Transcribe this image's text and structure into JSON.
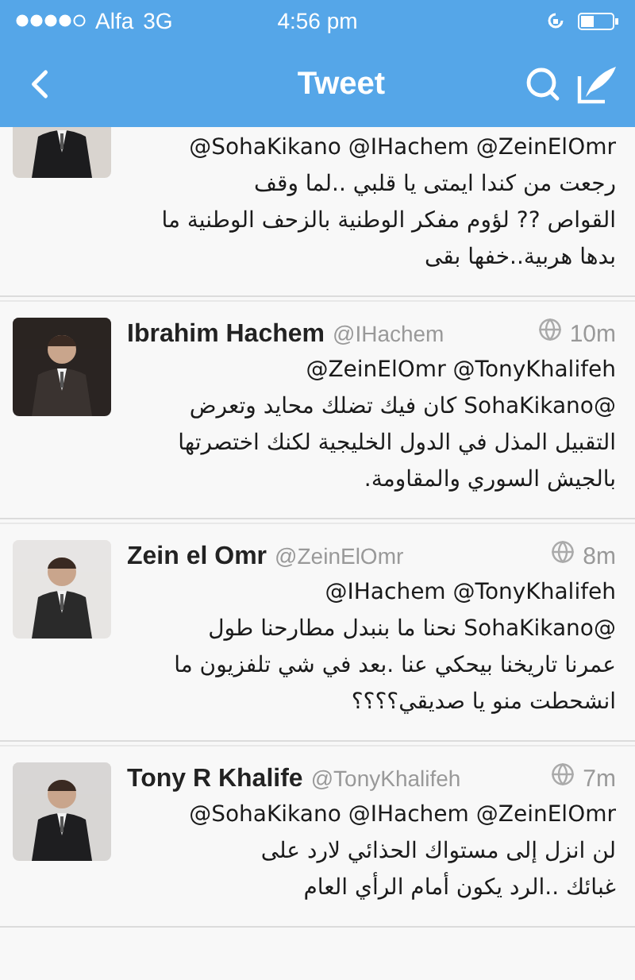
{
  "status_bar": {
    "carrier": "Alfa",
    "network": "3G",
    "time": "4:56 pm"
  },
  "nav_bar": {
    "title": "Tweet"
  },
  "tweets": [
    {
      "cut_top": true,
      "avatar": {
        "kind": "picture"
      },
      "lines": [
        {
          "kind": "mentions",
          "text": "@SohaKikano @IHachem @ZeinElOmr"
        },
        {
          "kind": "text",
          "text": "رجعت من كندا ايمتى يا قلبي ..لما وقف"
        },
        {
          "kind": "text",
          "text": "القواص ?? لؤوم مفكر الوطنية بالزحف الوطنية ما"
        },
        {
          "kind": "text",
          "text": "بدها هربية..خفها بقى"
        }
      ]
    },
    {
      "cut_top": false,
      "avatar": {
        "kind": "picture"
      },
      "name": "Ibrahim Hachem",
      "handle": "@IHachem",
      "time": "10m",
      "lines": [
        {
          "kind": "mentions",
          "text": "@ZeinElOmr @TonyKhalifeh"
        },
        {
          "kind": "text",
          "text": "@SohaKikano كان فيك تضلك محايد وتعرض"
        },
        {
          "kind": "text",
          "text": "التقبيل المذل في الدول الخليجية لكنك اختصرتها"
        },
        {
          "kind": "text",
          "text": "بالجيش السوري والمقاومة."
        }
      ]
    },
    {
      "cut_top": false,
      "avatar": {
        "kind": "picture"
      },
      "name": "Zein el Omr",
      "handle": "@ZeinElOmr",
      "time": "8m",
      "lines": [
        {
          "kind": "mentions",
          "text": "@IHachem @TonyKhalifeh"
        },
        {
          "kind": "text",
          "text": "@SohaKikano نحنا ما بنبدل مطارحنا طول"
        },
        {
          "kind": "text",
          "text": "عمرنا تاريخنا بيحكي عنا .بعد في شي تلفزيون ما"
        },
        {
          "kind": "text",
          "text": "انشحطت منو يا صديقي؟؟؟؟"
        }
      ]
    },
    {
      "cut_top": false,
      "avatar": {
        "kind": "picture"
      },
      "name": "Tony R Khalife",
      "handle": "@TonyKhalifeh",
      "time": "7m",
      "lines": [
        {
          "kind": "mentions",
          "text": "@SohaKikano @IHachem @ZeinElOmr"
        },
        {
          "kind": "text",
          "text": "لن انزل إلى مستواك الحذائي لارد على"
        },
        {
          "kind": "text",
          "text": "غبائك ..الرد يكون أمام الرأي العام"
        }
      ]
    }
  ]
}
